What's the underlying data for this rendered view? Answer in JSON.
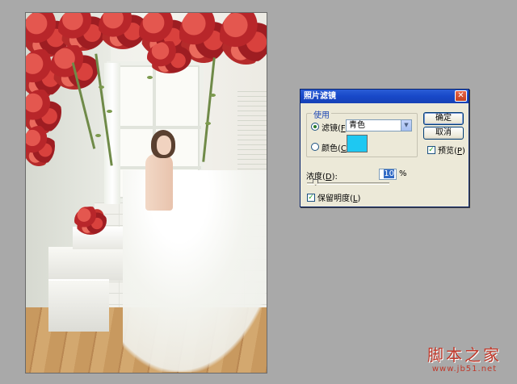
{
  "dialog": {
    "title": "照片滤镜",
    "close_glyph": "✕",
    "group_label": "使用",
    "filter": {
      "label": "滤镜",
      "shortcut": "F",
      "selected": "青色"
    },
    "color": {
      "label": "颜色",
      "shortcut": "C",
      "swatch_color": "#1ec8f2"
    },
    "buttons": {
      "ok": "确定",
      "cancel": "取消"
    },
    "preview": {
      "label": "预览",
      "shortcut": "P",
      "checked": true
    },
    "density": {
      "label": "浓度",
      "shortcut": "D",
      "value": "10",
      "unit": "%",
      "slider_percent": 10
    },
    "preserve_luminosity": {
      "label": "保留明度",
      "shortcut": "L",
      "checked": true
    }
  },
  "watermark": {
    "main": "脚本之家",
    "url": "www.jb51.net"
  }
}
